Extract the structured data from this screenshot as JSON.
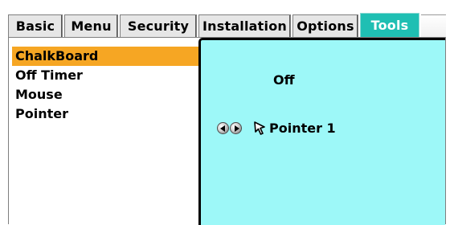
{
  "tabs": [
    {
      "label": "Basic",
      "active": false
    },
    {
      "label": "Menu",
      "active": false
    },
    {
      "label": "Security",
      "active": false
    },
    {
      "label": "Installation",
      "active": false
    },
    {
      "label": "Options",
      "active": false
    },
    {
      "label": "Tools",
      "active": true
    }
  ],
  "sidebar": {
    "items": [
      {
        "label": "ChalkBoard",
        "selected": true
      },
      {
        "label": "Off Timer",
        "selected": false
      },
      {
        "label": "Mouse",
        "selected": false
      },
      {
        "label": "Pointer",
        "selected": false
      }
    ]
  },
  "content": {
    "off_timer_value": "Off",
    "pointer_value": "Pointer 1",
    "pointer_icon": "arrow-cursor-icon",
    "adjust_icons": [
      "left-arrow-icon",
      "right-arrow-icon"
    ]
  },
  "colors": {
    "active_tab": "#1fbfb3",
    "selected_item": "#f6a623",
    "content_background": "#9df8f8"
  }
}
